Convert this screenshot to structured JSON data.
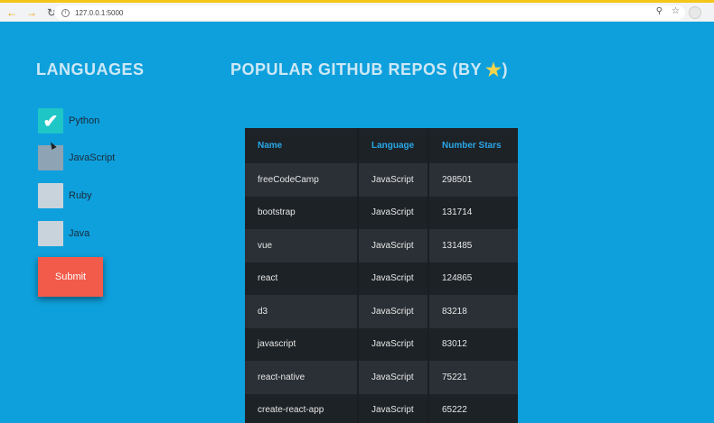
{
  "browser": {
    "url": "127.0.0.1:5000"
  },
  "sidebar": {
    "title": "LANGUAGES",
    "languages": [
      {
        "label": "Python",
        "checked": true
      },
      {
        "label": "JavaScript",
        "checked": false
      },
      {
        "label": "Ruby",
        "checked": false
      },
      {
        "label": "Java",
        "checked": false
      }
    ],
    "submit_label": "Submit"
  },
  "main": {
    "title": "POPULAR GITHUB REPOS (BY",
    "title_end": ")",
    "columns": [
      "Name",
      "Language",
      "Number Stars"
    ],
    "rows": [
      [
        "freeCodeCamp",
        "JavaScript",
        "298501"
      ],
      [
        "bootstrap",
        "JavaScript",
        "131714"
      ],
      [
        "vue",
        "JavaScript",
        "131485"
      ],
      [
        "react",
        "JavaScript",
        "124865"
      ],
      [
        "d3",
        "JavaScript",
        "83218"
      ],
      [
        "javascript",
        "JavaScript",
        "83012"
      ],
      [
        "react-native",
        "JavaScript",
        "75221"
      ],
      [
        "create-react-app",
        "JavaScript",
        "65222"
      ]
    ]
  },
  "colors": {
    "background": "#0ea0dc",
    "checked": "#1ec6c6",
    "submit": "#f25a4a",
    "table_header_text": "#2aa7e8"
  }
}
